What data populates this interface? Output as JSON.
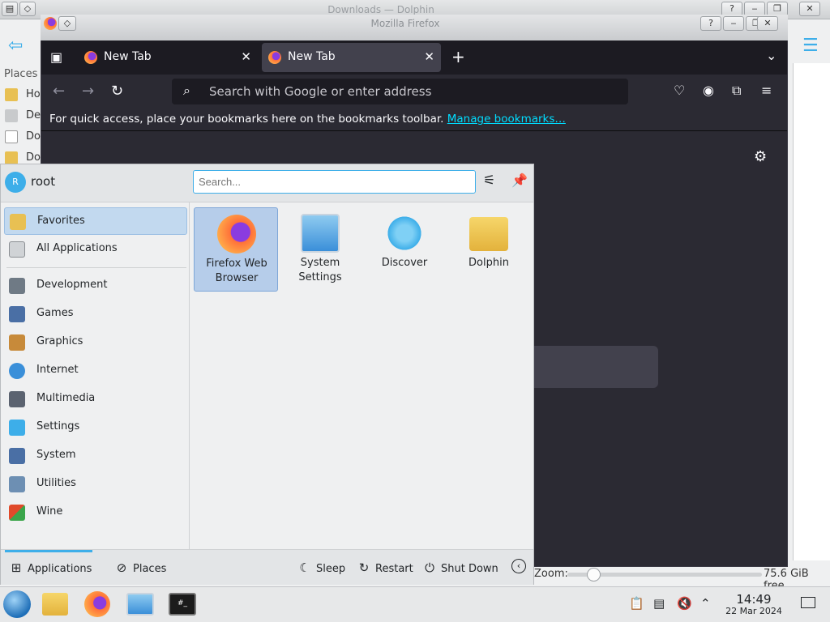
{
  "dolphin": {
    "title": "Downloads — Dolphin",
    "places_label": "Places",
    "places": [
      "Ho",
      "De",
      "Do",
      "Do"
    ],
    "zoom_label": "Zoom:",
    "free_space": "75.6 GiB free"
  },
  "firefox": {
    "window_title": "Mozilla Firefox",
    "tabs": [
      {
        "label": "New Tab",
        "active": false
      },
      {
        "label": "New Tab",
        "active": true
      }
    ],
    "url_placeholder": "Search with Google or enter address",
    "bookmarks_text": "For quick access, place your bookmarks here on the bookmarks toolbar.",
    "bookmarks_link": "Manage bookmarks…"
  },
  "launcher": {
    "user_initial": "R",
    "username": "root",
    "search_placeholder": "Search...",
    "categories": [
      {
        "label": "Favorites",
        "icon": "star-folder-icon",
        "color": "#e8c053"
      },
      {
        "label": "All Applications",
        "icon": "grid-icon",
        "color": "#8a8e92"
      },
      {
        "label": "Development",
        "icon": "development-icon",
        "color": "#6f7a85"
      },
      {
        "label": "Games",
        "icon": "games-icon",
        "color": "#4a6fa5"
      },
      {
        "label": "Graphics",
        "icon": "graphics-icon",
        "color": "#c78a3a"
      },
      {
        "label": "Internet",
        "icon": "internet-icon",
        "color": "#3a8fd9"
      },
      {
        "label": "Multimedia",
        "icon": "multimedia-icon",
        "color": "#5b6370"
      },
      {
        "label": "Settings",
        "icon": "settings-icon",
        "color": "#3daee9"
      },
      {
        "label": "System",
        "icon": "system-icon",
        "color": "#4a6fa5"
      },
      {
        "label": "Utilities",
        "icon": "utilities-icon",
        "color": "#6d8fb3"
      },
      {
        "label": "Wine",
        "icon": "wine-icon",
        "color": "#e04a2a"
      }
    ],
    "apps": [
      {
        "label": "Firefox Web Browser",
        "icon": "firefox-icon"
      },
      {
        "label": "System Settings",
        "icon": "system-settings-icon"
      },
      {
        "label": "Discover",
        "icon": "discover-icon"
      },
      {
        "label": "Dolphin",
        "icon": "dolphin-folder-icon"
      }
    ],
    "footer": {
      "applications": "Applications",
      "places": "Places",
      "sleep": "Sleep",
      "restart": "Restart",
      "shutdown": "Shut Down"
    }
  },
  "taskbar": {
    "time": "14:49",
    "date": "22 Mar 2024"
  },
  "colors": {
    "accent": "#3daee9",
    "firefox_bg": "#2b2a33",
    "link": "#00ddff"
  }
}
